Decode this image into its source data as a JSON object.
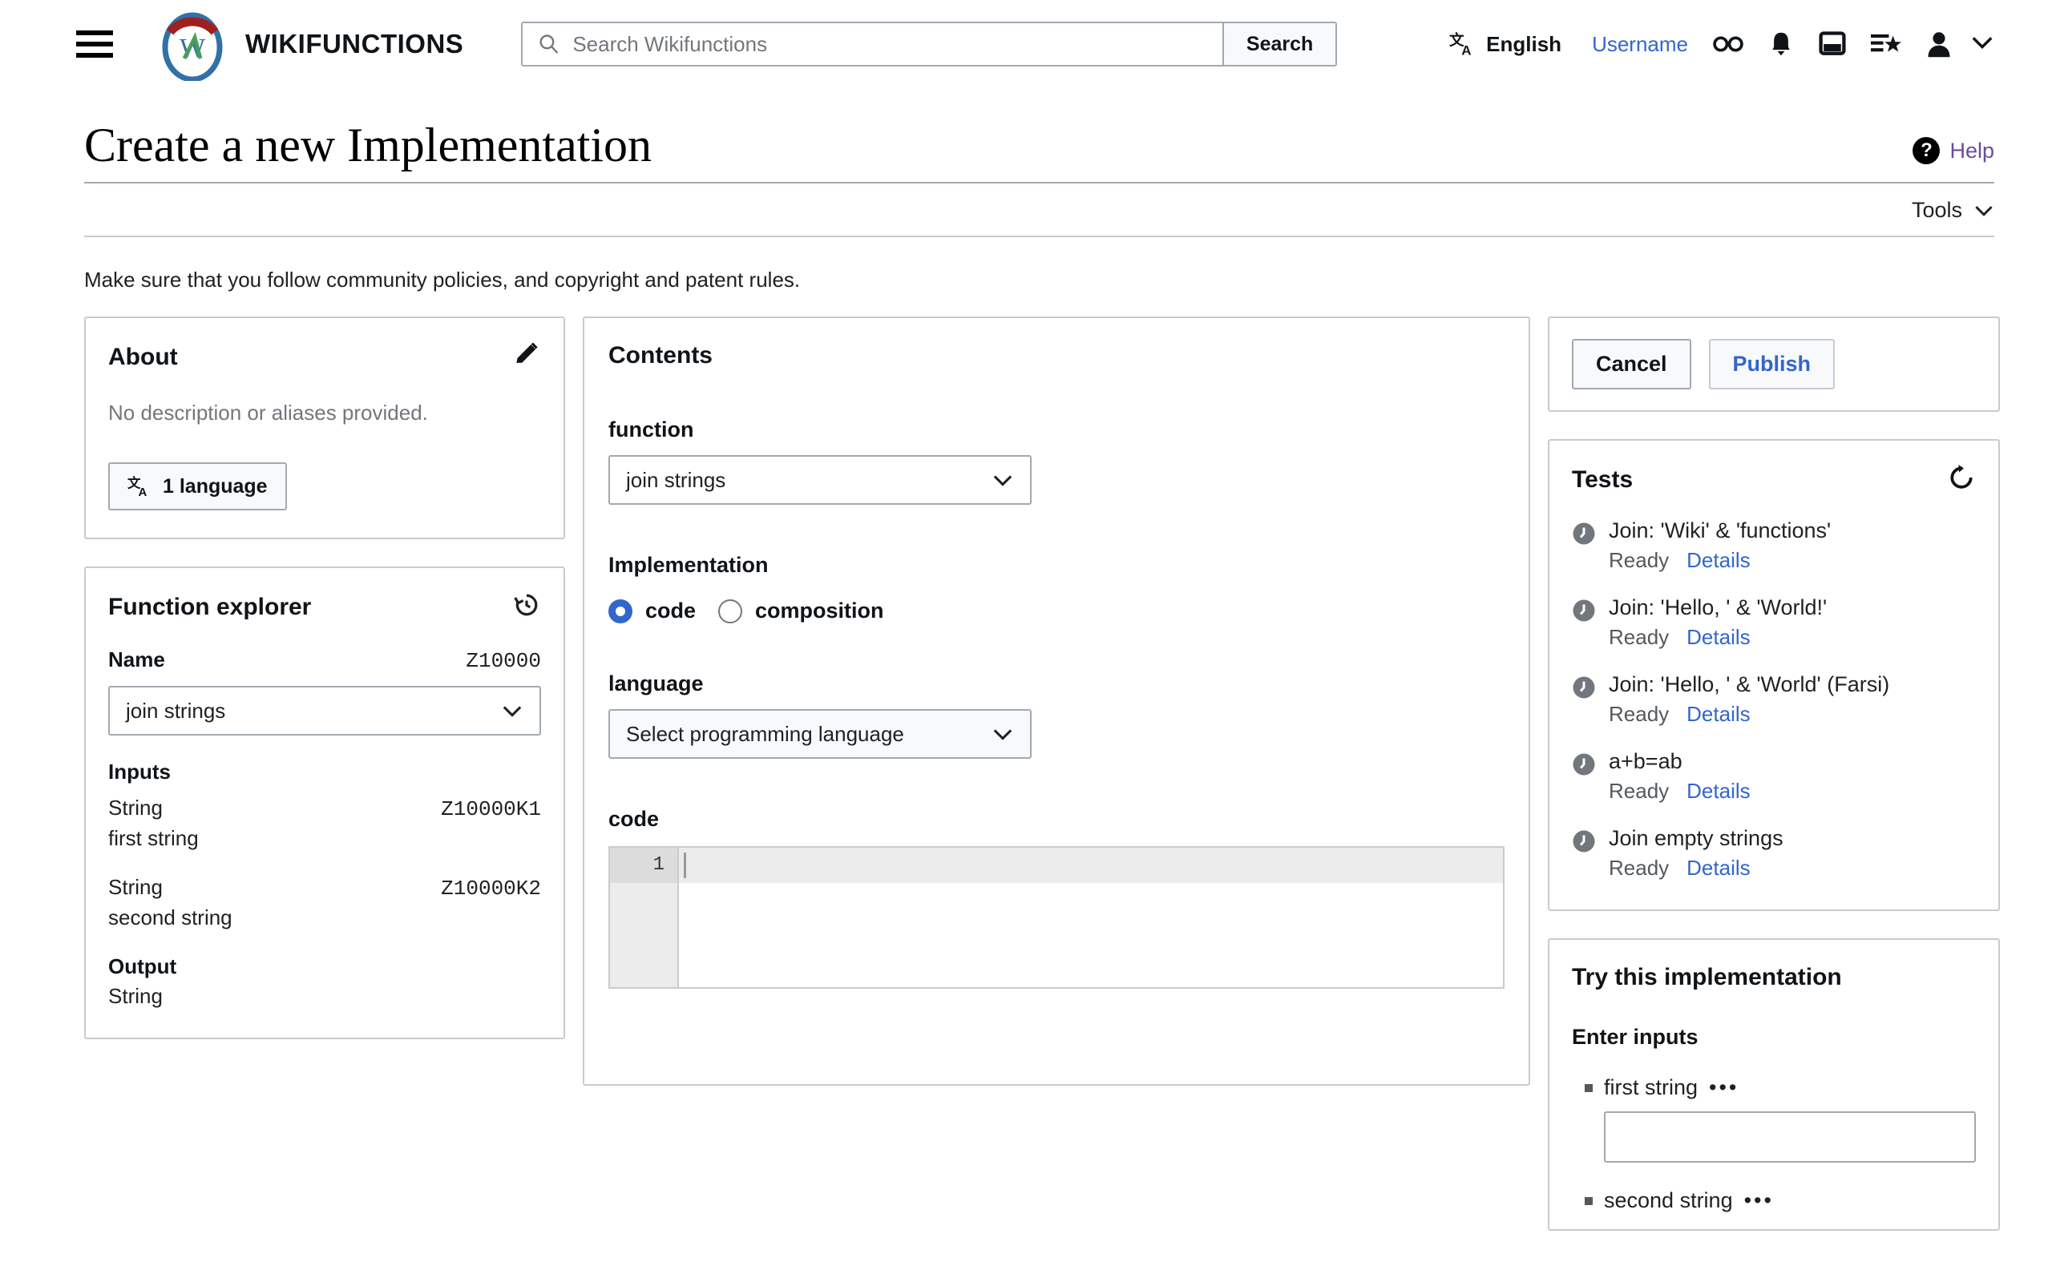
{
  "header": {
    "menu_icon": "hamburger-menu-icon",
    "wordmark": "WIKIFUNCTIONS",
    "search": {
      "placeholder": "Search Wikifunctions",
      "value": "",
      "button_label": "Search",
      "icon": "search-icon"
    },
    "language_label": "English",
    "username": "Username",
    "icons": [
      "watchlist-glasses-icon",
      "notification-bell-icon",
      "talk-page-icon",
      "watchlist-star-icon",
      "user-avatar-icon",
      "chevron-down-icon"
    ]
  },
  "page": {
    "title": "Create a new Implementation",
    "help_label": "Help",
    "help_icon": "question-mark-icon",
    "tools_label": "Tools",
    "policy_note": "Make sure that you follow community policies, and copyright and patent rules."
  },
  "about": {
    "title": "About",
    "edit_icon": "pencil-edit-icon",
    "description": "No description or aliases provided.",
    "language_button": "1 language",
    "language_icon": "translate-icon"
  },
  "function_explorer": {
    "title": "Function explorer",
    "history_icon": "history-revert-icon",
    "name_label": "Name",
    "name_zid": "Z10000",
    "selected_function": "join strings",
    "inputs_label": "Inputs",
    "inputs": [
      {
        "type": "String",
        "zid": "Z10000K1",
        "description": "first string"
      },
      {
        "type": "String",
        "zid": "Z10000K2",
        "description": "second string"
      }
    ],
    "output_label": "Output",
    "output_type": "String"
  },
  "contents": {
    "title": "Contents",
    "function_label": "function",
    "function_value": "join strings",
    "implementation_label": "Implementation",
    "radio_code": "code",
    "radio_composition": "composition",
    "selected_implementation": "code",
    "language_label": "language",
    "language_value": "Select programming language",
    "code_label": "code",
    "code_line_number": "1",
    "code_value": ""
  },
  "actions": {
    "cancel_label": "Cancel",
    "publish_label": "Publish"
  },
  "tests": {
    "title": "Tests",
    "refresh_icon": "refresh-icon",
    "items": [
      {
        "name": "Join: 'Wiki' & 'functions'",
        "status": "Ready",
        "details_label": "Details",
        "status_icon": "clock-pending-icon"
      },
      {
        "name": "Join: 'Hello, ' & 'World!'",
        "status": "Ready",
        "details_label": "Details",
        "status_icon": "clock-pending-icon"
      },
      {
        "name": "Join: 'Hello, ' & 'World' (Farsi)",
        "status": "Ready",
        "details_label": "Details",
        "status_icon": "clock-pending-icon"
      },
      {
        "name": "a+b=ab",
        "status": "Ready",
        "details_label": "Details",
        "status_icon": "clock-pending-icon"
      },
      {
        "name": "Join empty strings",
        "status": "Ready",
        "details_label": "Details",
        "status_icon": "clock-pending-icon"
      }
    ]
  },
  "try_panel": {
    "title": "Try this implementation",
    "enter_inputs_label": "Enter inputs",
    "inputs": [
      {
        "label": "first string",
        "value": "",
        "menu_icon": "ellipsis-menu-icon"
      },
      {
        "label": "second string",
        "value": "",
        "menu_icon": "ellipsis-menu-icon"
      }
    ]
  },
  "colors": {
    "link_blue": "#3366cc",
    "visited_purple": "#6b4ba1",
    "border_gray": "#c8ccd1",
    "muted_gray": "#72777d"
  }
}
